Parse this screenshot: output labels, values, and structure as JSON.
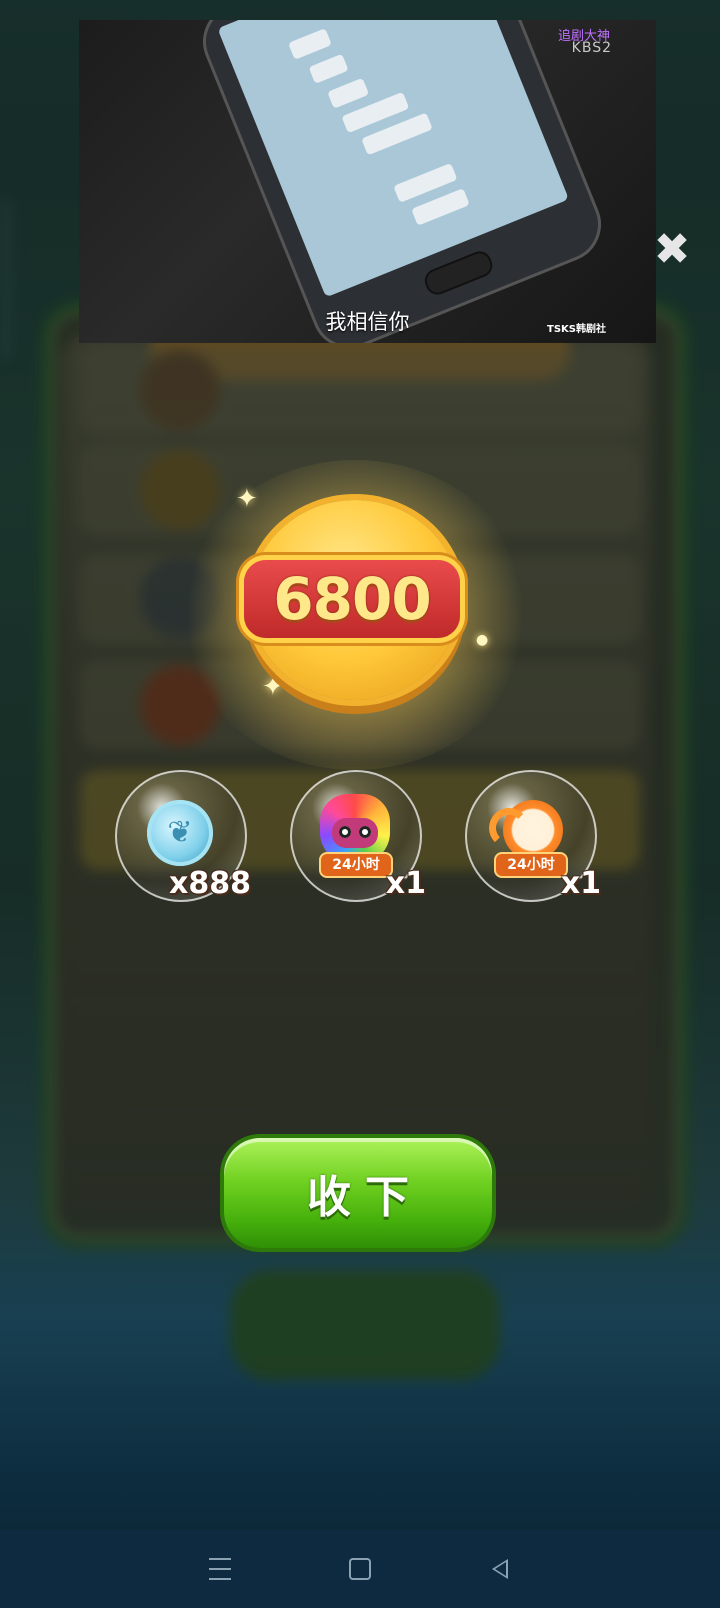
{
  "video_ad": {
    "subtitle": "我相信你",
    "tag": "追剧大神",
    "channel": "KBS2",
    "credit": "TSKS韩剧社"
  },
  "close_symbol": "✖",
  "coin": {
    "value": "6800"
  },
  "rewards": [
    {
      "icon": "feather-coin-icon",
      "duration": "",
      "quantity": "x888"
    },
    {
      "icon": "rainbow-owl-icon",
      "duration": "24小时",
      "quantity": "x1"
    },
    {
      "icon": "clock-boost-icon",
      "duration": "24小时",
      "quantity": "x1"
    }
  ],
  "collect_button": {
    "label": "收下"
  },
  "colors": {
    "accent_green": "#46b00c",
    "coin_gold": "#ffc93a",
    "coin_plate_red": "#c02a2a",
    "nav_bg": "#0e2a40"
  }
}
